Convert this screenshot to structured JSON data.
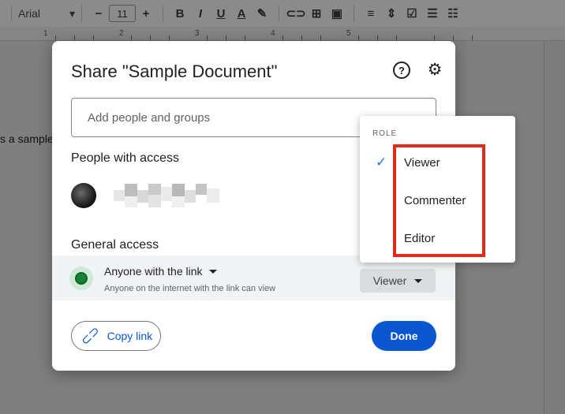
{
  "toolbar": {
    "font_name": "Arial",
    "font_size": "11",
    "buttons": [
      "minus",
      "plus",
      "bold",
      "italic",
      "underline",
      "text-color",
      "highlight",
      "link",
      "comment",
      "image",
      "align",
      "line-spacing",
      "checklist",
      "bullets"
    ]
  },
  "ruler": {
    "marks": [
      "1",
      "2",
      "3",
      "4",
      "5"
    ]
  },
  "document": {
    "visible_text": "s a sample"
  },
  "dialog": {
    "title": "Share \"Sample Document\"",
    "help_label": "?",
    "add_placeholder": "Add people and groups",
    "people_heading": "People with access",
    "general_heading": "General access",
    "access": {
      "main": "Anyone with the link",
      "sub": "Anyone on the internet with the link can view",
      "role": "Viewer"
    },
    "copy_link": "Copy link",
    "done": "Done"
  },
  "role_menu": {
    "header": "ROLE",
    "items": [
      {
        "label": "Viewer",
        "selected": true
      },
      {
        "label": "Commenter",
        "selected": false
      },
      {
        "label": "Editor",
        "selected": false
      }
    ]
  },
  "colors": {
    "accent": "#0b57d0",
    "highlight_box": "#e02b1a",
    "check": "#1a73e8"
  }
}
